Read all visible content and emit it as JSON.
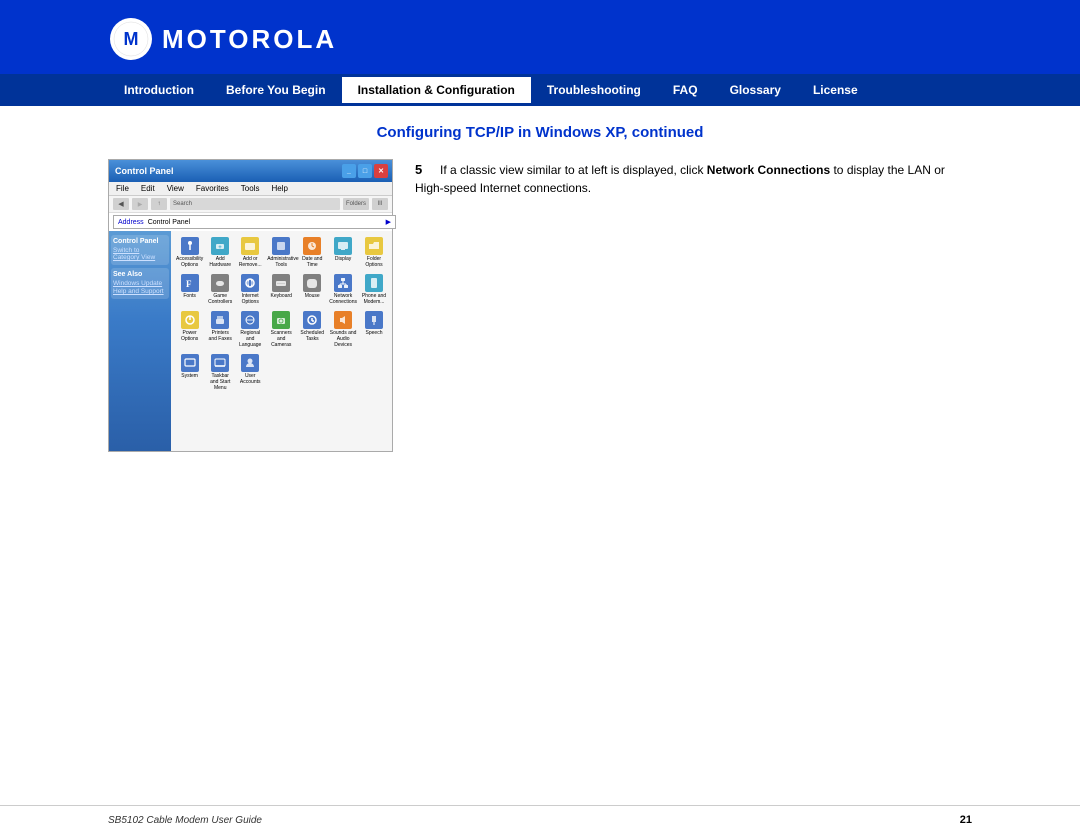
{
  "header": {
    "brand": "MOTOROLA",
    "logo_symbol": "M"
  },
  "nav": {
    "items": [
      {
        "id": "introduction",
        "label": "Introduction",
        "active": false
      },
      {
        "id": "before-you-begin",
        "label": "Before You Begin",
        "active": false
      },
      {
        "id": "installation-configuration",
        "label": "Installation & Configuration",
        "active": true
      },
      {
        "id": "troubleshooting",
        "label": "Troubleshooting",
        "active": false
      },
      {
        "id": "faq",
        "label": "FAQ",
        "active": false
      },
      {
        "id": "glossary",
        "label": "Glossary",
        "active": false
      },
      {
        "id": "license",
        "label": "License",
        "active": false
      }
    ]
  },
  "page": {
    "title": "Configuring TCP/IP in Windows XP, continued",
    "step_number": "5",
    "step_text_before_bold": "If a classic view similar to at left is displayed, click ",
    "step_bold": "Network Connections",
    "step_text_after_bold": " to display the LAN or High-speed Internet connections."
  },
  "screenshot": {
    "title": "Control Panel",
    "menu_items": [
      "File",
      "Edit",
      "View",
      "Favorites",
      "Tools",
      "Help"
    ],
    "address": "Control Panel",
    "sidebar": {
      "section1_title": "Control Panel",
      "section1_link": "Switch to Category View",
      "section2_title": "See Also",
      "section2_links": [
        "Windows Update",
        "Help and Support"
      ]
    },
    "icons": [
      {
        "label": "Accessibility Options",
        "color": "blue"
      },
      {
        "label": "Add Hardware",
        "color": "teal"
      },
      {
        "label": "Add or Remove...",
        "color": "yellow"
      },
      {
        "label": "Administrative Tools",
        "color": "blue"
      },
      {
        "label": "Date and Time",
        "color": "orange"
      },
      {
        "label": "Display",
        "color": "teal"
      },
      {
        "label": "Folder Options",
        "color": "yellow"
      },
      {
        "label": "Fonts",
        "color": "blue"
      },
      {
        "label": "Game Controllers",
        "color": "gray"
      },
      {
        "label": "Internet Options",
        "color": "blue"
      },
      {
        "label": "Keyboard",
        "color": "gray"
      },
      {
        "label": "Mouse",
        "color": "gray"
      },
      {
        "label": "Network Connections",
        "color": "blue"
      },
      {
        "label": "Phone and Modem...",
        "color": "teal"
      },
      {
        "label": "Power Options",
        "color": "yellow"
      },
      {
        "label": "Printers and Faxes",
        "color": "blue"
      },
      {
        "label": "Regional and Language",
        "color": "blue"
      },
      {
        "label": "Scanners and Cameras",
        "color": "green"
      },
      {
        "label": "Scheduled Tasks",
        "color": "blue"
      },
      {
        "label": "Sounds and Audio Devices",
        "color": "orange"
      },
      {
        "label": "Speech",
        "color": "blue"
      },
      {
        "label": "System",
        "color": "blue"
      },
      {
        "label": "Taskbar and Start Menu",
        "color": "blue"
      },
      {
        "label": "User Accounts",
        "color": "blue"
      }
    ]
  },
  "footer": {
    "document_title": "SB5102 Cable Modem User Guide",
    "page_number": "21"
  }
}
